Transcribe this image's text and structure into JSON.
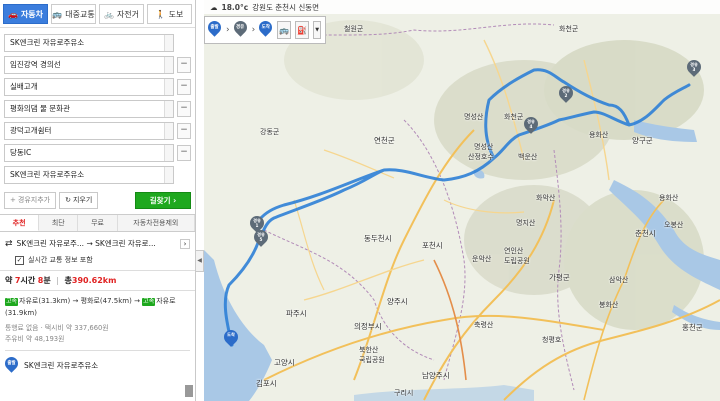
{
  "sidebar": {
    "modes": [
      {
        "icon": "car-icon",
        "glyph": "🚗",
        "label": "자동차"
      },
      {
        "icon": "bus-icon",
        "glyph": "🚌",
        "label": "대중교통"
      },
      {
        "icon": "bicycle-icon",
        "glyph": "🚲",
        "label": "자전거"
      },
      {
        "icon": "walk-icon",
        "glyph": "🚶",
        "label": "도보"
      }
    ],
    "stops": [
      {
        "value": "SK엔크린 자유로주유소",
        "has_remove": false
      },
      {
        "value": "임진강역 경의선",
        "has_remove": true
      },
      {
        "value": "실배고개",
        "has_remove": true
      },
      {
        "value": "평화의댐 물 문화관",
        "has_remove": true
      },
      {
        "value": "광덕고개쉼터",
        "has_remove": true
      },
      {
        "value": "당동IC",
        "has_remove": true
      },
      {
        "value": "SK엔크린 자유로주유소",
        "has_remove": false
      }
    ],
    "remove_glyph": "−",
    "add_waypoint_label": "경유지추가",
    "add_glyph": "+",
    "clear_label": "지우기",
    "clear_glyph": "↻",
    "search_button_label": "길찾기",
    "search_button_glyph": "›",
    "option_tabs": [
      "추천",
      "최단",
      "무료",
      "자동차전용제외"
    ],
    "route_summary": "SK엔크린 자유로주... → SK엔크린 자유로...",
    "route_prefix": "⇄",
    "route_more": "›",
    "realtime_label": "실시간 교통 정보 포함",
    "realtime_checked": "✓",
    "time_prefix": "약",
    "time_hours": "7",
    "time_hours_unit": "시간",
    "time_minutes": "8",
    "time_minutes_unit": "분",
    "distance_prefix": "총",
    "distance": "390.62",
    "distance_unit": "km",
    "segments_line1_a": "자유로(31.3km) → 평화로(47.5km) →",
    "segments_line1_b": "자유로",
    "segments_line2": "(31.9km)",
    "hw_badge": "고속",
    "toll_info": "통행료 없음 · 택시비 약 337,660원",
    "fuel_info": "주유비 약 48,193원",
    "start_pin": "출발",
    "start_name": "SK엔크린 자유로주유소",
    "collapse_glyph": "◀"
  },
  "map": {
    "weather": "18.0°c",
    "location": "강원도 춘천시 신동면",
    "weather_icon": "cloud-icon",
    "via": [
      {
        "label": "출발",
        "color": "#2c6cc9"
      },
      {
        "label": "경유",
        "color": "#5d6b78"
      },
      {
        "label": "도착",
        "color": "#2c6cc9"
      }
    ],
    "via_arrow": "›",
    "tool_bus": "🚌",
    "tool_fuel": "⛽",
    "tool_dd": "▼",
    "place_labels": {
      "cheolwon": "철원군",
      "hwacheon": "화천군",
      "yanggu": "양구군",
      "gangseo": "강동군",
      "yeoncheon": "연천군",
      "myeongseongsan": "명성산",
      "sanjeong": "산정호수",
      "baegunsan": "백운산",
      "hwaaksan": "화악산",
      "yongwha": "용화산",
      "osan": "오봉산",
      "dongducheon": "동두천시",
      "pocheon": "포천시",
      "unaksan": "운악산",
      "yeonin": "연인산",
      "doripgongwon": "도립공원",
      "myeongjisan": "명지산",
      "chuncheon": "춘천시",
      "gapyeong": "가평군",
      "samaksan": "삼악산",
      "paju": "파주시",
      "yangju": "양주시",
      "uijeongbu": "의정부시",
      "namyangju": "남양주시",
      "goyang": "고양시",
      "gimpo": "김포시",
      "guri": "구리시",
      "bukhansan": "북한산",
      "gukripgongwon": "국립공원",
      "chukryeong": "축령산",
      "cheongpyeong": "청평호",
      "bongsan": "봉화산",
      "hongcheon": "홍천군"
    },
    "pins": [
      {
        "id": "via-1",
        "label": "경유\n1"
      },
      {
        "id": "via-2",
        "label": "경유\n2"
      },
      {
        "id": "via-3",
        "label": "경유\n3"
      },
      {
        "id": "via-4",
        "label": "경유\n4"
      },
      {
        "id": "via-5",
        "label": "경유\n5"
      },
      {
        "id": "end",
        "label": "도착"
      }
    ]
  }
}
